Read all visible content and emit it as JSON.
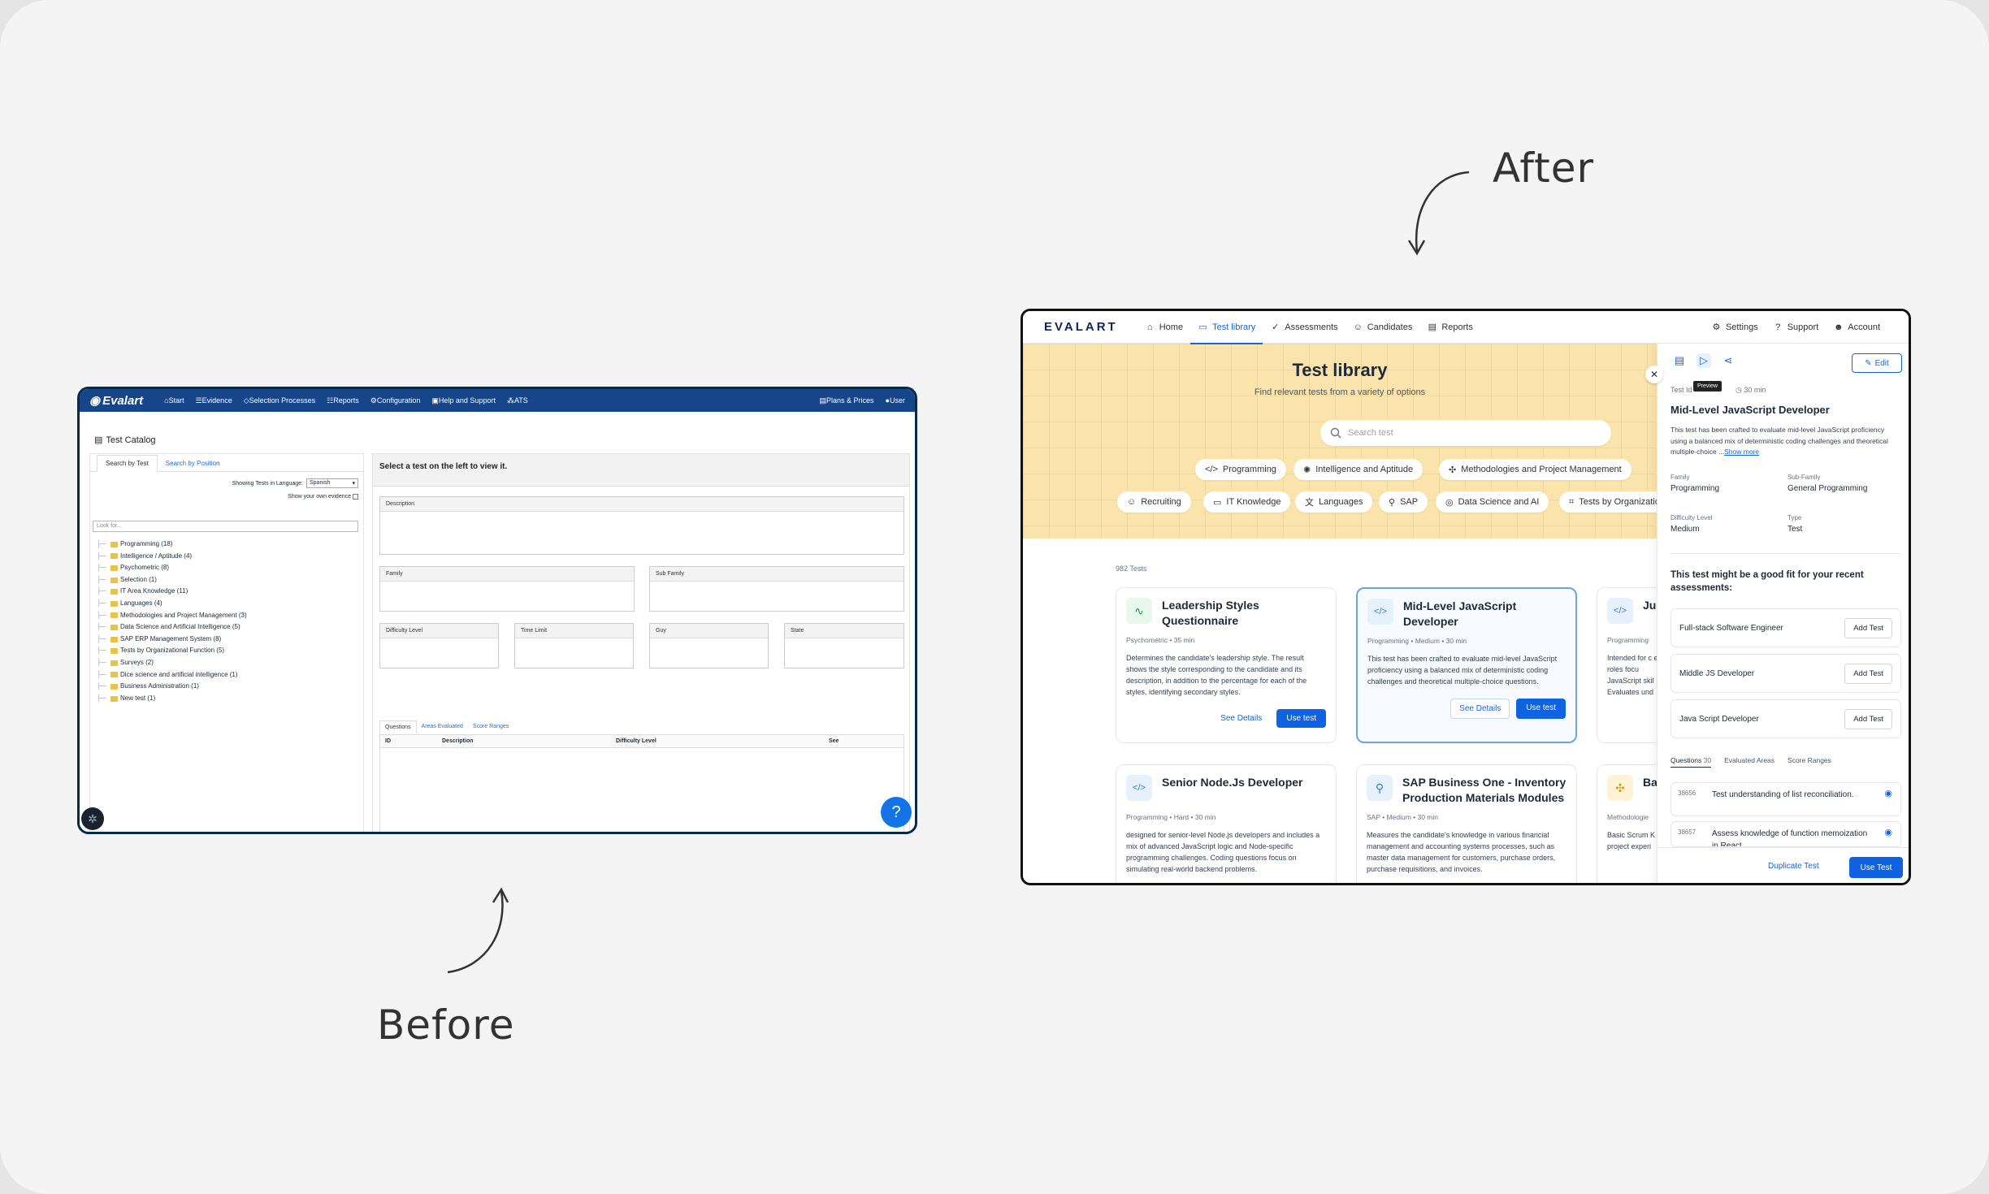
{
  "labels": {
    "after": "After",
    "before": "Before"
  },
  "before": {
    "nav": {
      "logo": "Evalart",
      "items": [
        "Start",
        "Evidence",
        "Selection Processes",
        "Reports",
        "Configuration",
        "Help and Support",
        "ATS"
      ],
      "right": [
        "Plans & Prices",
        "User"
      ]
    },
    "page_title": "Test Catalog",
    "tabs": [
      "Search by Test",
      "Search by Position"
    ],
    "language_label": "Showing Tests in Language:",
    "language_value": "Spanish",
    "own_evidence_label": "Show your own evidence",
    "search_placeholder": "Look for...",
    "tree": [
      "Programming (18)",
      "Intelligence / Aptitude (4)",
      "Psychometric (8)",
      "Selection (1)",
      "IT Area Knowledge (11)",
      "Languages (4)",
      "Methodologies and Project Management (3)",
      "Data Science and Artificial Intelligence (5)",
      "SAP ERP Management System (8)",
      "Tests by Organizational Function (5)",
      "Surveys (2)",
      "Dice science and artificial intelligence (1)",
      "Business Administration (1)",
      "New test (1)"
    ],
    "select_prompt": "Select a test on the left to view it.",
    "fields": {
      "description": "Description",
      "family": "Family",
      "sub_family": "Sub Family",
      "difficulty": "Difficulty Level",
      "time_limit": "Time Limit",
      "guy": "Guy",
      "state": "State"
    },
    "question_tabs": [
      "Questions",
      "Areas Evaluated",
      "Score Ranges"
    ],
    "table_headers": [
      "ID",
      "Description",
      "Difficulty Level",
      "See"
    ],
    "help": "?"
  },
  "after": {
    "nav": {
      "logo": "EVALART",
      "items": [
        {
          "label": "Home",
          "icon": "home-icon"
        },
        {
          "label": "Test library",
          "icon": "book-icon",
          "active": true
        },
        {
          "label": "Assessments",
          "icon": "check-circle-icon"
        },
        {
          "label": "Candidates",
          "icon": "users-icon"
        },
        {
          "label": "Reports",
          "icon": "document-icon"
        }
      ],
      "right": [
        {
          "label": "Settings",
          "icon": "gear-icon"
        },
        {
          "label": "Support",
          "icon": "help-icon"
        },
        {
          "label": "Account",
          "icon": "user-icon"
        }
      ]
    },
    "hero": {
      "title": "Test library",
      "subtitle": "Find relevant tests from a variety of options",
      "search_placeholder": "Search test"
    },
    "chips_row1": [
      "Programming",
      "Intelligence and Aptitude",
      "Methodologies and Project Management"
    ],
    "chips_row2": [
      "Recruiting",
      "IT Knowledge",
      "Languages",
      "SAP",
      "Data Science and AI",
      "Tests by Organizatio"
    ],
    "count": "982 Tests",
    "cards": [
      {
        "title": "Leadership Styles Questionnaire",
        "meta": "Psychometric  •  35 min",
        "desc": "Determines the candidate's leadership style. The result shows the style corresponding to the candidate and its description, in addition to the percentage for each of the styles, identifying secondary styles.",
        "details": "See Details",
        "use": "Use test"
      },
      {
        "title": "Mid-Level JavaScript Developer",
        "meta": "Programming  •  Medium  •  30 min",
        "desc": "This test has been crafted to evaluate mid-level JavaScript proficiency using a balanced mix of deterministic coding challenges and theoretical multiple-choice questions.",
        "details": "See Details",
        "use": "Use test"
      },
      {
        "title": "Ju",
        "meta": "Programming",
        "desc": "Intended for c end roles focu JavaScript skil Evaluates und"
      },
      {
        "title": "Senior Node.Js Developer",
        "meta": "Programming  •  Hard  •  30 min",
        "desc": "designed for senior-level Node.js developers and includes a mix of advanced JavaScript logic and Node-specific programming challenges. Coding questions focus on simulating real-world backend problems."
      },
      {
        "title": "SAP Business One - Inventory Production Materials Modules",
        "meta": "SAP  •  Medium  •  30 min",
        "desc": "Measures the candidate's knowledge in various financial management and accounting systems processes, such as master data management for customers, purchase orders, purchase requisitions, and invoices."
      },
      {
        "title": "Ba",
        "meta": "Methodologie",
        "desc": "Basic Scrum K project experi"
      }
    ],
    "panel": {
      "tooltip": "Preview",
      "edit": "Edit",
      "test_id": "Test Id",
      "time": "30 min",
      "title": "Mid-Level JavaScript Developer",
      "desc": "This test has been crafted to evaluate mid-level JavaScript proficiency using a balanced mix of deterministic coding challenges and theoretical multiple-choice ...",
      "show_more": "Show more",
      "family_label": "Family",
      "family": "Programming",
      "subfamily_label": "Sub-Family",
      "subfamily": "General Programming",
      "difficulty_label": "Difficulty Level",
      "difficulty": "Medium",
      "type_label": "Type",
      "type": "Test",
      "suggest": "This test might be a good fit for your recent assessments:",
      "suggestions": [
        "Full-stack Software Engineer",
        "Middle JS Developer",
        "Java Script Developer"
      ],
      "add_label": "Add Test",
      "tabs": [
        "Questions",
        "Evaluated Areas",
        "Score Ranges"
      ],
      "questions_count": "30",
      "questions": [
        {
          "id": "38656",
          "text": "Test understanding of list reconciliation."
        },
        {
          "id": "38657",
          "text": "Assess knowledge of function memoization in React"
        }
      ],
      "duplicate": "Duplicate Test",
      "use": "Use Test"
    }
  }
}
